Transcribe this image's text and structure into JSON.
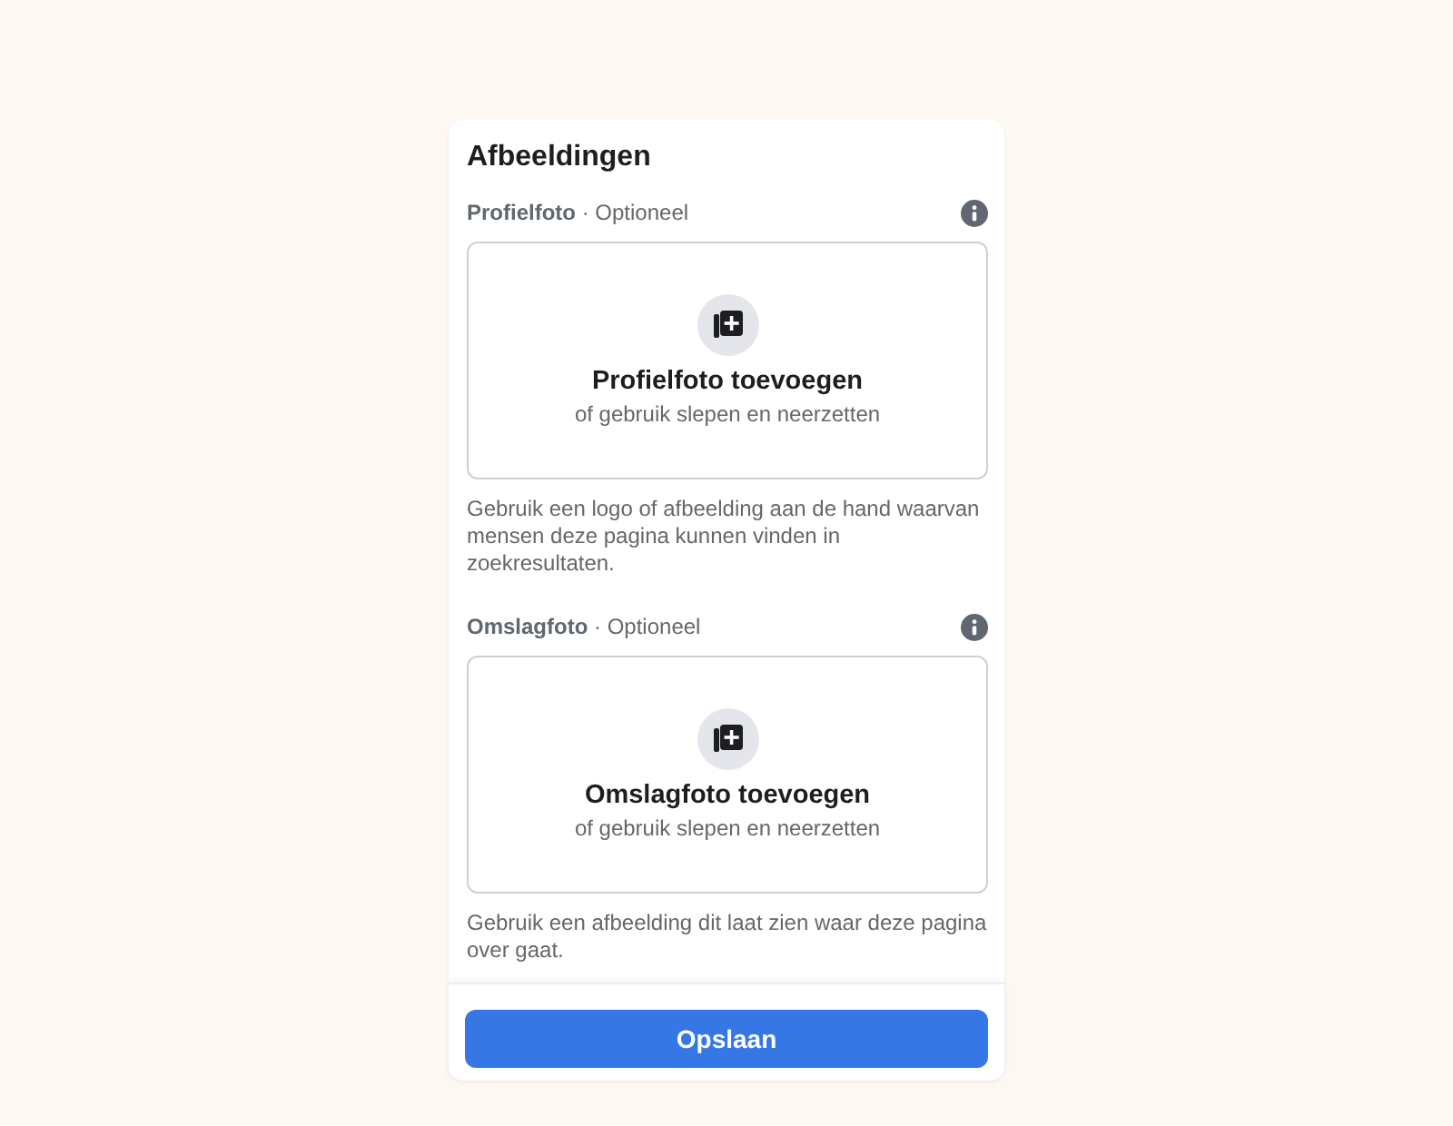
{
  "card": {
    "title": "Afbeeldingen"
  },
  "sections": [
    {
      "label": "**Profielfoto** · Optioneel",
      "upload_title": "Profielfoto toevoegen",
      "upload_hint": "of gebruik slepen en neerzetten",
      "help": "Gebruik een logo of afbeelding aan de hand waarvan mensen deze pagina kunnen vinden in zoekresultaten."
    },
    {
      "label": "**Omslagfoto** · Optioneel",
      "upload_title": "Omslagfoto toevoegen",
      "upload_hint": "of gebruik slepen en neerzetten",
      "help": "Gebruik een afbeelding dit laat zien waar deze pagina over gaat."
    }
  ],
  "save_button": "Opslaan"
}
